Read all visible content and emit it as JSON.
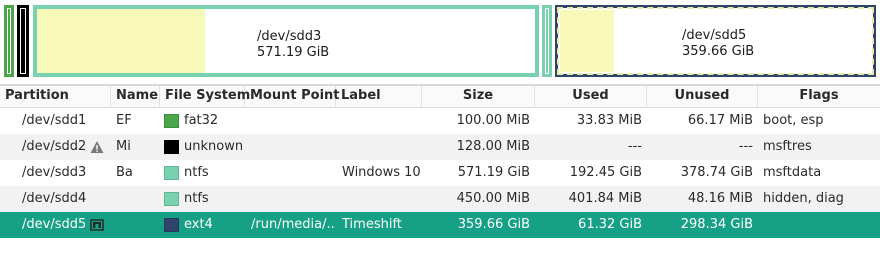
{
  "disk_map": {
    "partitions": [
      {
        "name": "/dev/sdd3",
        "size": "571.19 GiB"
      },
      {
        "name": "/dev/sdd5",
        "size": "359.66 GiB"
      }
    ]
  },
  "table": {
    "columns": [
      "Partition",
      "Name",
      "File System",
      "Mount Point",
      "Label",
      "Size",
      "Used",
      "Unused",
      "Flags"
    ],
    "rows": [
      {
        "partition": "/dev/sdd1",
        "name": "EF",
        "fs": "fat32",
        "fs_color": "#4aa64a",
        "mount": "",
        "label": "",
        "size": "100.00 MiB",
        "used": "33.83 MiB",
        "unused": "66.17 MiB",
        "flags": "boot, esp"
      },
      {
        "partition": "/dev/sdd2",
        "name": "Mi",
        "fs": "unknown",
        "fs_color": "#000000",
        "mount": "",
        "label": "",
        "size": "128.00 MiB",
        "used": "---",
        "unused": "---",
        "flags": "msftres",
        "icon": "warning-icon"
      },
      {
        "partition": "/dev/sdd3",
        "name": "Ba",
        "fs": "ntfs",
        "fs_color": "#78d2b0",
        "mount": "",
        "label": "Windows 10",
        "size": "571.19 GiB",
        "used": "192.45 GiB",
        "unused": "378.74 GiB",
        "flags": "msftdata"
      },
      {
        "partition": "/dev/sdd4",
        "name": "",
        "fs": "ntfs",
        "fs_color": "#78d2b0",
        "mount": "",
        "label": "",
        "size": "450.00 MiB",
        "used": "401.84 MiB",
        "unused": "48.16 MiB",
        "flags": "hidden, diag"
      },
      {
        "partition": "/dev/sdd5",
        "name": "",
        "fs": "ext4",
        "fs_color": "#2f4468",
        "mount": "/run/media/...",
        "label": "Timeshift",
        "size": "359.66 GiB",
        "used": "61.32 GiB",
        "unused": "298.34 GiB",
        "flags": "",
        "icon": "lock-icon",
        "selected": true
      }
    ]
  },
  "colors": {
    "selection": "#16a085",
    "used_space": "#f8f8b8"
  }
}
